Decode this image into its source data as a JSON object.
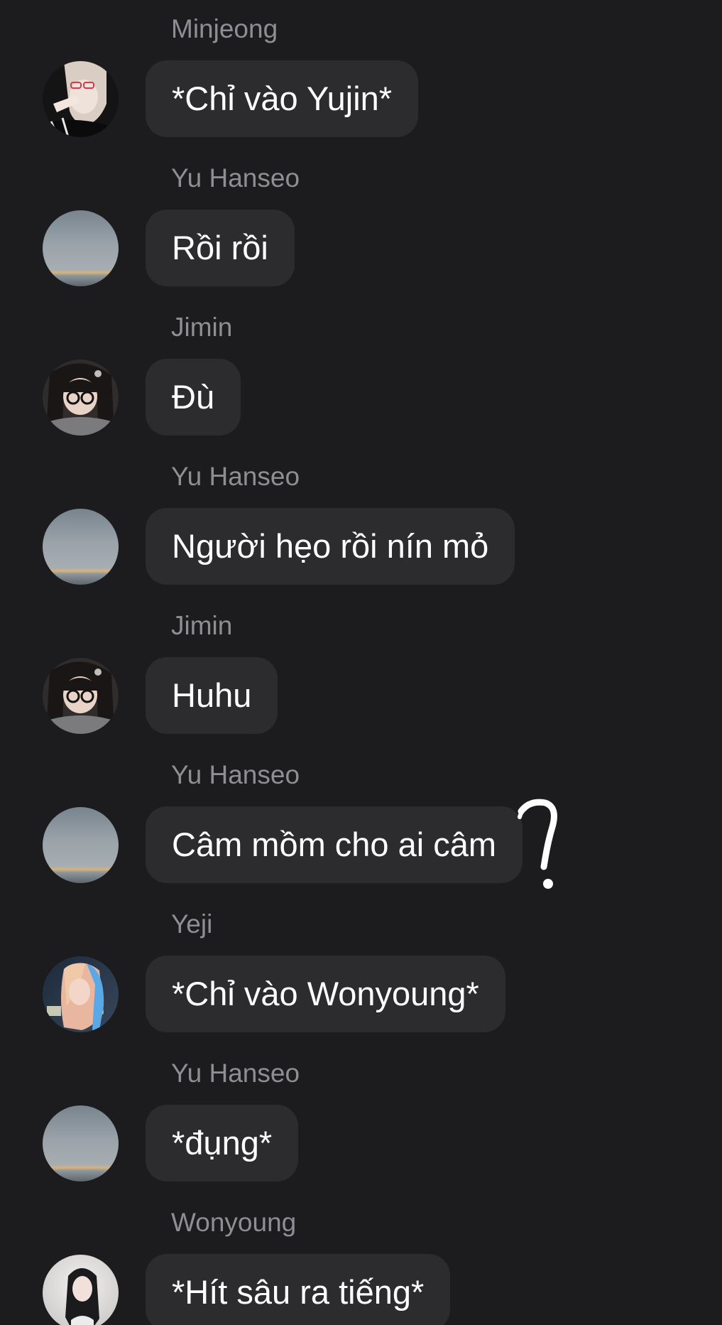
{
  "messages": [
    {
      "sender": "Minjeong",
      "avatar": "minjeong-avatar",
      "text": "*Chỉ vào Yujin*"
    },
    {
      "sender": "Yu Hanseo",
      "avatar": "sky-avatar",
      "text": "Rồi rồi"
    },
    {
      "sender": "Jimin",
      "avatar": "jimin-avatar",
      "text": "Đù"
    },
    {
      "sender": "Yu Hanseo",
      "avatar": "sky-avatar",
      "text": "Người hẹo rồi nín mỏ"
    },
    {
      "sender": "Jimin",
      "avatar": "jimin-avatar",
      "text": "Huhu"
    },
    {
      "sender": "Yu Hanseo",
      "avatar": "sky-avatar",
      "text": "Câm mồm cho ai câm"
    },
    {
      "sender": "Yeji",
      "avatar": "yeji-avatar",
      "text": "*Chỉ vào Wonyoung*"
    },
    {
      "sender": "Yu Hanseo",
      "avatar": "sky-avatar",
      "text": "*đụng*"
    },
    {
      "sender": "Wonyoung",
      "avatar": "wonyoung-avatar",
      "text": "*Hít sâu ra tiếng*"
    }
  ],
  "annotation": {
    "icon": "handwritten-question-mark",
    "color": "#ffffff"
  },
  "colors": {
    "background": "#1c1c1e",
    "bubble": "#2c2c2e",
    "sender": "#8e8e93",
    "text": "#ffffff"
  }
}
